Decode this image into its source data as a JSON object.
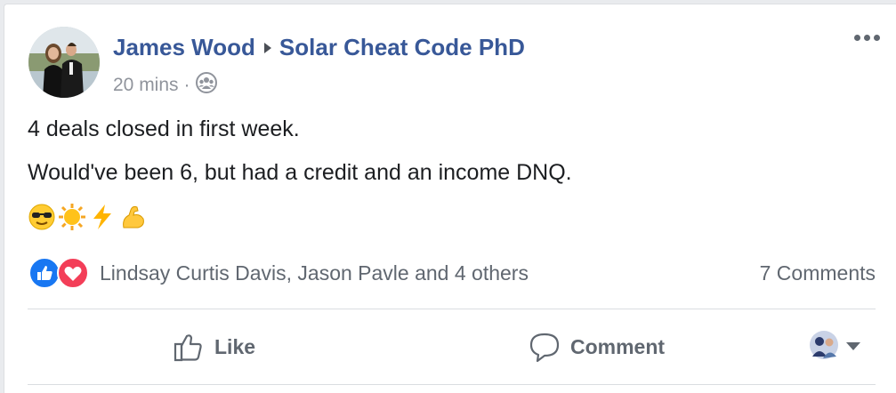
{
  "post": {
    "author": "James Wood",
    "group": "Solar Cheat Code PhD",
    "time": "20 mins",
    "separator": "·",
    "audience_icon": "group-icon",
    "text_line1": "4 deals closed in first week.",
    "text_line2": "Would've been 6, but had a credit and an income DNQ.",
    "emojis": [
      "sunglasses-face",
      "sun",
      "lightning-bolt",
      "flexed-biceps"
    ]
  },
  "reactions": {
    "names": "Lindsay Curtis Davis, Jason Pavle and 4 others",
    "comments": "7 Comments",
    "icons": [
      "like-reaction-icon",
      "love-reaction-icon"
    ]
  },
  "actions": {
    "like_label": "Like",
    "comment_label": "Comment"
  },
  "colors": {
    "link": "#385898",
    "secondary_text": "#606770",
    "meta_text": "#90949c",
    "like_blue": "#1877f2",
    "love_red": "#f33e58"
  }
}
